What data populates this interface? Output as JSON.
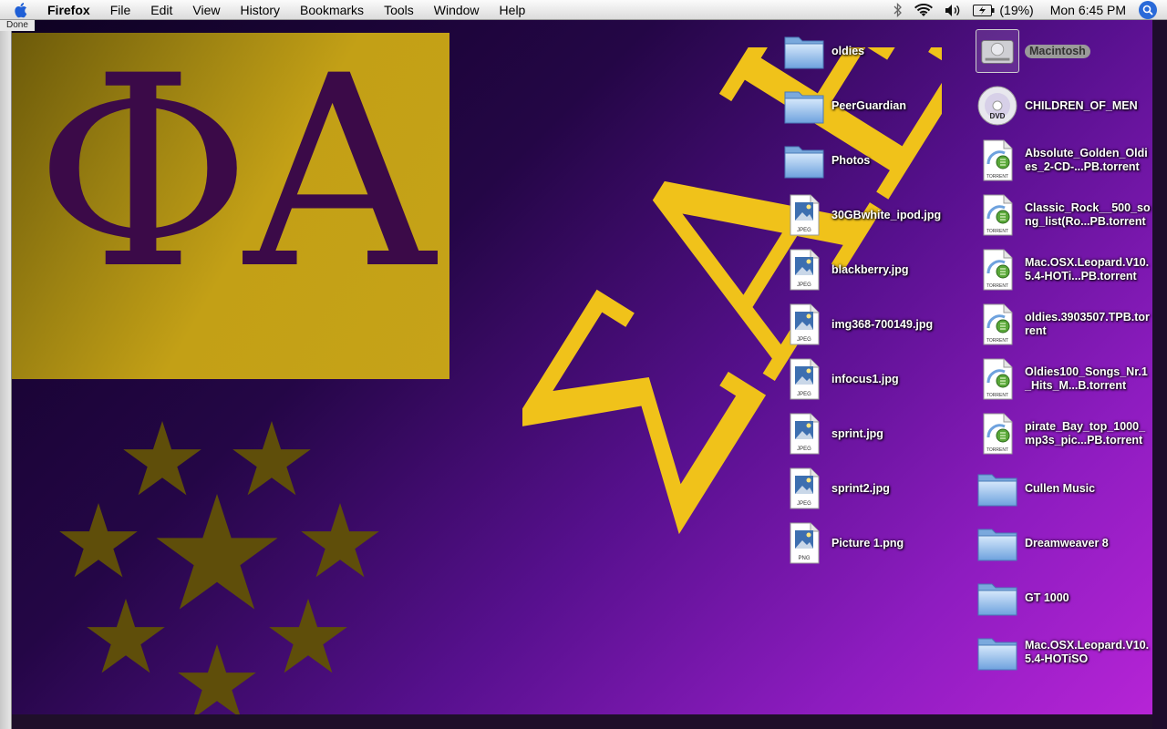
{
  "menubar": {
    "app": "Firefox",
    "items": [
      "File",
      "Edit",
      "View",
      "History",
      "Bookmarks",
      "Tools",
      "Window",
      "Help"
    ],
    "battery": "(19%)",
    "clock": "Mon 6:45 PM"
  },
  "firefox": {
    "status": "Done"
  },
  "wallpaper": {
    "letters": "ΦΑ",
    "script_letters": "ΣΑΕ"
  },
  "desktop": {
    "column1": [
      {
        "label": "oldies",
        "icon": "folder-icon"
      },
      {
        "label": "PeerGuardian",
        "icon": "folder-icon"
      },
      {
        "label": "Photos",
        "icon": "folder-icon"
      },
      {
        "label": "30GBwhite_ipod.jpg",
        "icon": "jpeg-file-icon",
        "badge": "JPEG"
      },
      {
        "label": "blackberry.jpg",
        "icon": "jpeg-file-icon",
        "badge": "JPEG"
      },
      {
        "label": "img368-700149.jpg",
        "icon": "jpeg-file-icon",
        "badge": "JPEG"
      },
      {
        "label": "infocus1.jpg",
        "icon": "jpeg-file-icon",
        "badge": "JPEG"
      },
      {
        "label": "sprint.jpg",
        "icon": "jpeg-file-icon",
        "badge": "JPEG"
      },
      {
        "label": "sprint2.jpg",
        "icon": "jpeg-file-icon",
        "badge": "JPEG"
      },
      {
        "label": "Picture 1.png",
        "icon": "png-file-icon",
        "badge": "PNG"
      }
    ],
    "column2": [
      {
        "label": "Macintosh",
        "icon": "hard-drive-icon"
      },
      {
        "label": "CHILDREN_OF_MEN",
        "icon": "dvd-icon",
        "badge": "DVD"
      },
      {
        "label": "Absolute_Golden_Oldies_2-CD-...PB.torrent",
        "icon": "torrent-file-icon",
        "badge": "TORRENT"
      },
      {
        "label": "Classic_Rock__500_song_list(Ro...PB.torrent",
        "icon": "torrent-file-icon",
        "badge": "TORRENT"
      },
      {
        "label": "Mac.OSX.Leopard.V10.5.4-HOTi...PB.torrent",
        "icon": "torrent-file-icon",
        "badge": "TORRENT"
      },
      {
        "label": "oldies.​3903507.TPB.torrent",
        "icon": "torrent-file-icon",
        "badge": "TORRENT"
      },
      {
        "label": "Oldies100_Songs_Nr.1_Hits_M...B.torrent",
        "icon": "torrent-file-icon",
        "badge": "TORRENT"
      },
      {
        "label": "pirate_Bay_top_1000_mp3s_pic...PB.torrent",
        "icon": "torrent-file-icon",
        "badge": "TORRENT"
      },
      {
        "label": "Cullen Music",
        "icon": "folder-icon"
      },
      {
        "label": "Dreamweaver 8",
        "icon": "folder-icon"
      },
      {
        "label": "GT 1000",
        "icon": "folder-icon"
      },
      {
        "label": "Mac.OSX.Leopard.V10.5.4-HOTiSO",
        "icon": "folder-icon"
      }
    ]
  }
}
